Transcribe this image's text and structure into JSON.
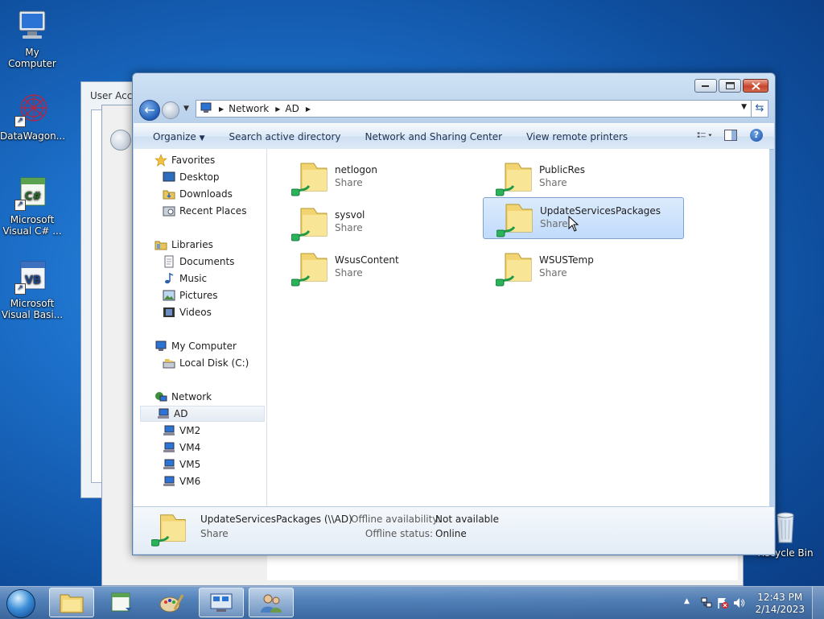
{
  "desktop": {
    "icons": [
      {
        "label": "My Computer"
      },
      {
        "label": "DataWagon..."
      },
      {
        "label": "Microsoft Visual C# ..."
      },
      {
        "label": "Microsoft Visual Basi..."
      },
      {
        "label": "Recycle Bin"
      }
    ],
    "csharp_glyph": "C#",
    "vb_glyph": "VB"
  },
  "background_window": {
    "title": "User Acco"
  },
  "explorer": {
    "address": {
      "segments": [
        "Network",
        "AD"
      ]
    },
    "toolbar": {
      "organize": "Organize",
      "search_ad": "Search active directory",
      "network_center": "Network and Sharing Center",
      "remote_printers": "View remote printers"
    },
    "nav": {
      "favorites": "Favorites",
      "desktop": "Desktop",
      "downloads": "Downloads",
      "recent": "Recent Places",
      "libraries": "Libraries",
      "documents": "Documents",
      "music": "Music",
      "pictures": "Pictures",
      "videos": "Videos",
      "computer": "My Computer",
      "local_disk": "Local Disk (C:)",
      "network": "Network",
      "hosts": [
        "AD",
        "VM2",
        "VM4",
        "VM5",
        "VM6"
      ]
    },
    "items": [
      {
        "name": "netlogon",
        "type": "Share"
      },
      {
        "name": "PublicRes",
        "type": "Share"
      },
      {
        "name": "sysvol",
        "type": "Share"
      },
      {
        "name": "UpdateServicesPackages",
        "type": "Share"
      },
      {
        "name": "WsusContent",
        "type": "Share"
      },
      {
        "name": "WSUSTemp",
        "type": "Share"
      }
    ],
    "details": {
      "name": "UpdateServicesPackages (\\\\AD)",
      "type": "Share",
      "availability_label": "Offline availability:",
      "availability_value": "Not available",
      "status_label": "Offline status:",
      "status_value": "Online"
    }
  },
  "taskbar": {
    "time": "12:43 PM",
    "date": "2/14/2023"
  }
}
